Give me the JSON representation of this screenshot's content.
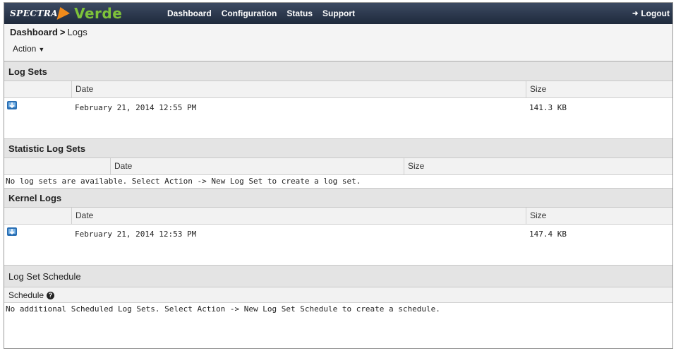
{
  "header": {
    "logo_spectra": "SPECTRA",
    "logo_verde": "Verde",
    "nav": [
      "Dashboard",
      "Configuration",
      "Status",
      "Support"
    ],
    "logout_label": "Logout"
  },
  "breadcrumb": {
    "home": "Dashboard",
    "separator": ">",
    "current": "Logs"
  },
  "action_menu": {
    "label": "Action"
  },
  "sections": {
    "log_sets": {
      "title": "Log Sets",
      "columns": [
        "Date",
        "Size"
      ],
      "rows": [
        {
          "date": "February 21, 2014 12:55 PM",
          "size": "141.3 KB",
          "icon": "download-icon"
        }
      ]
    },
    "statistic_log_sets": {
      "title": "Statistic Log Sets",
      "columns": [
        "Date",
        "Size"
      ],
      "empty_message": "No log sets are available. Select Action -> New Log Set to create a log set."
    },
    "kernel_logs": {
      "title": "Kernel Logs",
      "columns": [
        "Date",
        "Size"
      ],
      "rows": [
        {
          "date": "February 21, 2014 12:53 PM",
          "size": "147.4 KB",
          "icon": "download-icon"
        }
      ]
    },
    "log_set_schedule": {
      "title": "Log Set Schedule",
      "schedule_label": "Schedule",
      "help_icon": "?",
      "empty_message": "No additional Scheduled Log Sets. Select Action -> New Log Set Schedule to create a schedule."
    }
  },
  "colors": {
    "topbar": "#2b3648",
    "verde_green": "#7ec23a",
    "spectra_orange": "#f08a1c",
    "section_header": "#e4e4e4"
  }
}
